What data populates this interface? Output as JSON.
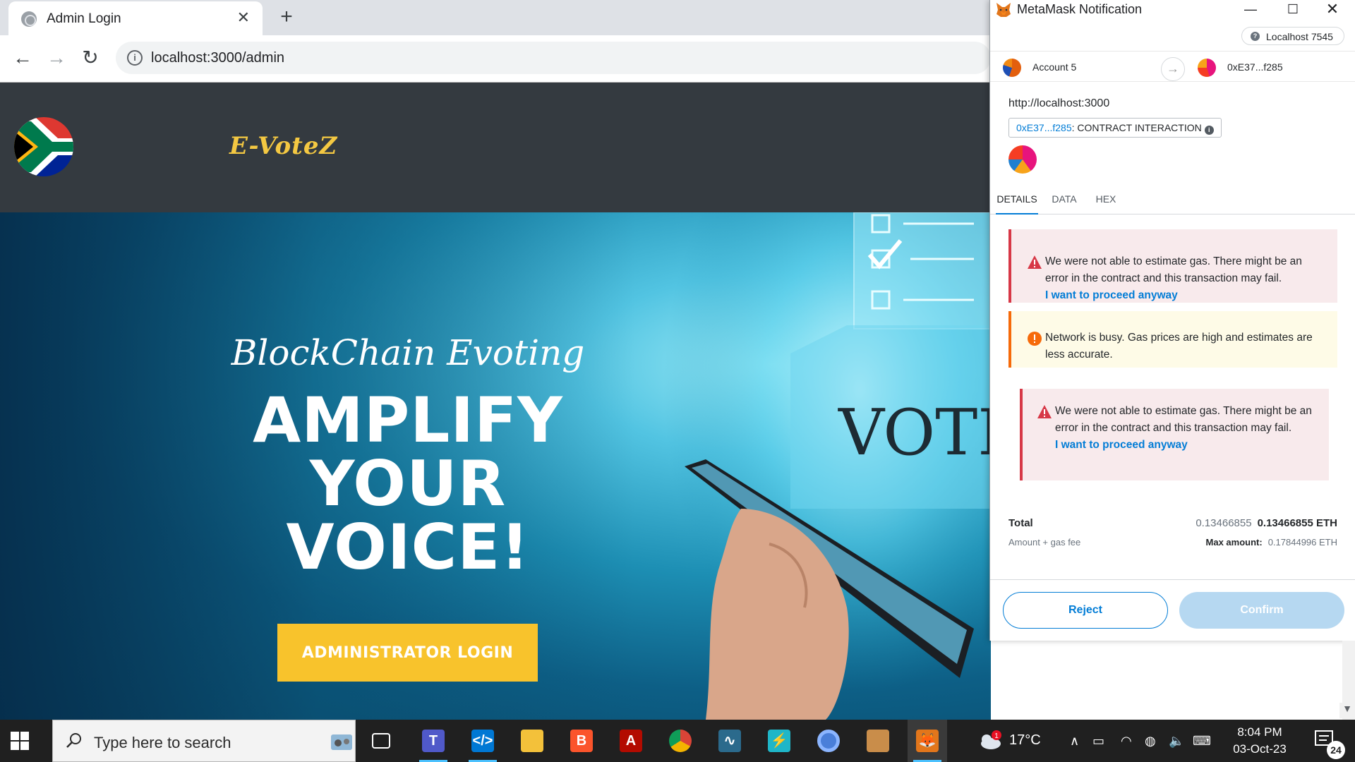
{
  "browser": {
    "tab_title": "Admin Login",
    "tab_close": "✕",
    "new_tab": "+",
    "back": "←",
    "forward": "→",
    "reload": "↻",
    "info_symbol": "i",
    "url": "localhost:3000/admin"
  },
  "site": {
    "brand": "E-VoteZ",
    "hero_subtitle": "BlockChain Evoting",
    "headline_lines": [
      "AMPLIFY",
      "YOUR",
      "VOICE!"
    ],
    "login_button": "ADMINISTRATOR LOGIN",
    "vote_text": "VOTE",
    "colors": {
      "header_bg": "#343a40",
      "brand": "#f4c842",
      "button": "#f8c32c"
    }
  },
  "metamask": {
    "window_title": "MetaMask Notification",
    "network": "Localhost 7545",
    "from_account": "Account 5",
    "to_account": "0xE37...f285",
    "origin": "http://localhost:3000",
    "contract_address": "0xE37...f285",
    "contract_label": ": CONTRACT INTERACTION",
    "tabs": [
      "DETAILS",
      "DATA",
      "HEX"
    ],
    "alerts": [
      {
        "type": "danger",
        "text": "We were not able to estimate gas. There might be an error in the contract and this transaction may fail.",
        "link": "I want to proceed anyway"
      },
      {
        "type": "warning",
        "text": "Network is busy. Gas prices are high and estimates are less accurate."
      },
      {
        "type": "danger",
        "text": "We were not able to estimate gas. There might be an error in the contract and this transaction may fail.",
        "link": "I want to proceed anyway"
      }
    ],
    "total": {
      "label": "Total",
      "sublabel": "Amount + gas fee",
      "amount_dim": "0.13466855",
      "amount": "0.13466855 ETH",
      "max_label": "Max amount:",
      "max_value": "0.17844996 ETH"
    },
    "reject_button": "Reject",
    "confirm_button": "Confirm",
    "colors": {
      "link": "#037dd6",
      "danger": "#d73847",
      "warning": "#f66a0a",
      "confirm_disabled": "#b6d8f1"
    }
  },
  "taskbar": {
    "search_placeholder": "Type here to search",
    "apps": [
      "task-view",
      "teams",
      "vscode",
      "file-explorer",
      "brave",
      "acrobat",
      "chrome",
      "matlab",
      "flash-app",
      "chromium",
      "package-app",
      "metamask"
    ],
    "temperature": "17°C",
    "time": "8:04 PM",
    "date": "03-Oct-23",
    "notification_count": "24",
    "weather_badge": "1"
  }
}
